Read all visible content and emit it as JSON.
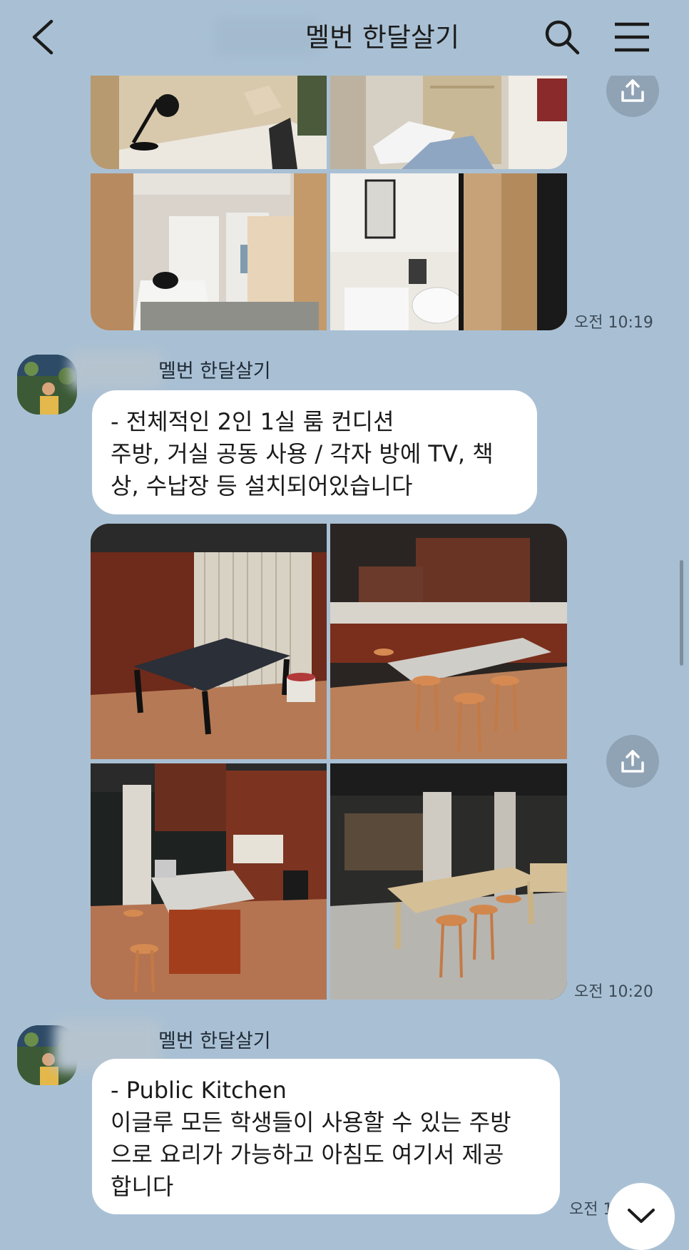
{
  "header": {
    "title": "멜번 한달살기",
    "back_icon": "chevron-left-icon",
    "search_icon": "search-icon",
    "menu_icon": "hamburger-menu-icon"
  },
  "messages": [
    {
      "type": "photos",
      "time": "오전 10:19",
      "photos": [
        "desk-lamp-room",
        "bed-with-pillow",
        "shared-living-area",
        "bathroom"
      ]
    },
    {
      "type": "text",
      "sender": "멜번 한달살기",
      "lines": [
        "- 전체적인 2인 1실 룸 컨디션",
        "주방, 거실 공동 사용 / 각자 방에 TV, 책",
        "상, 수납장 등 설치되어있습니다"
      ]
    },
    {
      "type": "photos",
      "time": "오전 10:20",
      "photos": [
        "ping-pong-table",
        "kitchen-island",
        "kitchen-counter",
        "dining-table"
      ]
    },
    {
      "type": "text",
      "sender": "멜번 한달살기",
      "time": "오전 1",
      "lines": [
        "- Public Kitchen",
        "이글루 모든 학생들이 사용할 수 있는 주방",
        "으로 요리가 가능하고 아침도 여기서 제공",
        "합니다"
      ]
    }
  ],
  "colors": {
    "chat_background": "#a9c0d4",
    "bubble": "#ffffff",
    "share_button": "#8fa3b5"
  },
  "icons": {
    "share": "share-upload-icon",
    "scroll_down": "chevron-down-icon"
  }
}
